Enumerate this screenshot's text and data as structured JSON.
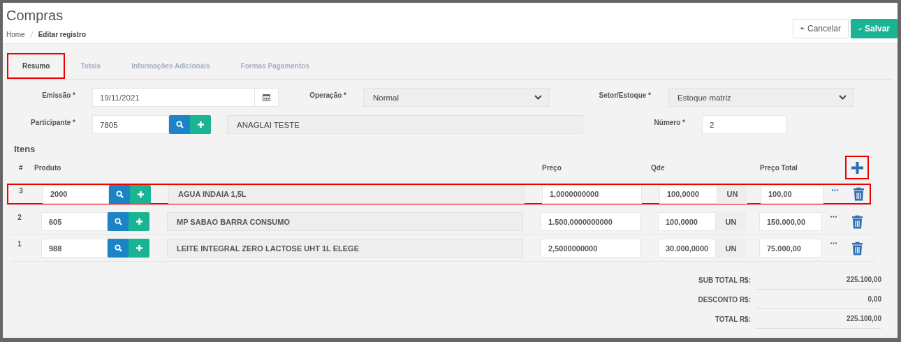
{
  "page": {
    "title": "Compras",
    "breadcrumb": [
      {
        "label": "Home",
        "kind": "link"
      },
      {
        "label": "Editar registro",
        "kind": "current"
      }
    ]
  },
  "actions": [
    {
      "kind": "cancel",
      "label": "Cancelar"
    },
    {
      "kind": "save",
      "label": "Salvar"
    }
  ],
  "tabs": [
    {
      "label": "Resumo",
      "selected": true,
      "highlighted": true
    },
    {
      "label": "Totais",
      "selected": false,
      "highlighted": false
    },
    {
      "label": "Informações Adicionais",
      "selected": false,
      "highlighted": false
    },
    {
      "label": "Formas Pagamentos",
      "selected": false,
      "highlighted": false
    }
  ],
  "form_rows": [
    [
      {
        "kind": "date",
        "label": "Emissão *",
        "value": "19/11/2021"
      },
      {
        "kind": "select",
        "label": "Operação *",
        "value": "Normal"
      },
      {
        "kind": "select",
        "label": "Setor/Estoque *",
        "value": "Estoque matriz"
      }
    ],
    [
      {
        "kind": "lookup",
        "label": "Participante *",
        "value": "7805",
        "name": "ANAGLAI TESTE"
      },
      {
        "kind": "text",
        "label": "Número *",
        "value": "2"
      }
    ]
  ],
  "items": {
    "title": "Itens",
    "columns": [
      "#",
      "Produto",
      "Preço",
      "Qde",
      "Preço Total"
    ],
    "add_highlighted": true,
    "rows": [
      {
        "number": "3",
        "code": "2000",
        "description": "AGUA INDAIA 1,5L",
        "price": "1,0000000000",
        "quantity": "100,0000",
        "unit": "UN",
        "total": "100,00",
        "highlighted": true
      },
      {
        "number": "2",
        "code": "605",
        "description": "MP SABAO BARRA CONSUMO",
        "price": "1.500,0000000000",
        "quantity": "100,0000",
        "unit": "UN",
        "total": "150.000,00",
        "highlighted": false
      },
      {
        "number": "1",
        "code": "988",
        "description": "LEITE INTEGRAL ZERO LACTOSE UHT 1L ELEGE",
        "price": "2,5000000000",
        "quantity": "30.000,0000",
        "unit": "UN",
        "total": "75.000,00",
        "highlighted": false
      }
    ]
  },
  "totals": [
    {
      "label": "SUB TOTAL R$:",
      "value": "225.100,00"
    },
    {
      "label": "DESCONTO R$:",
      "value": "0,00"
    },
    {
      "label": "TOTAL R$:",
      "value": "225.100,00"
    }
  ]
}
